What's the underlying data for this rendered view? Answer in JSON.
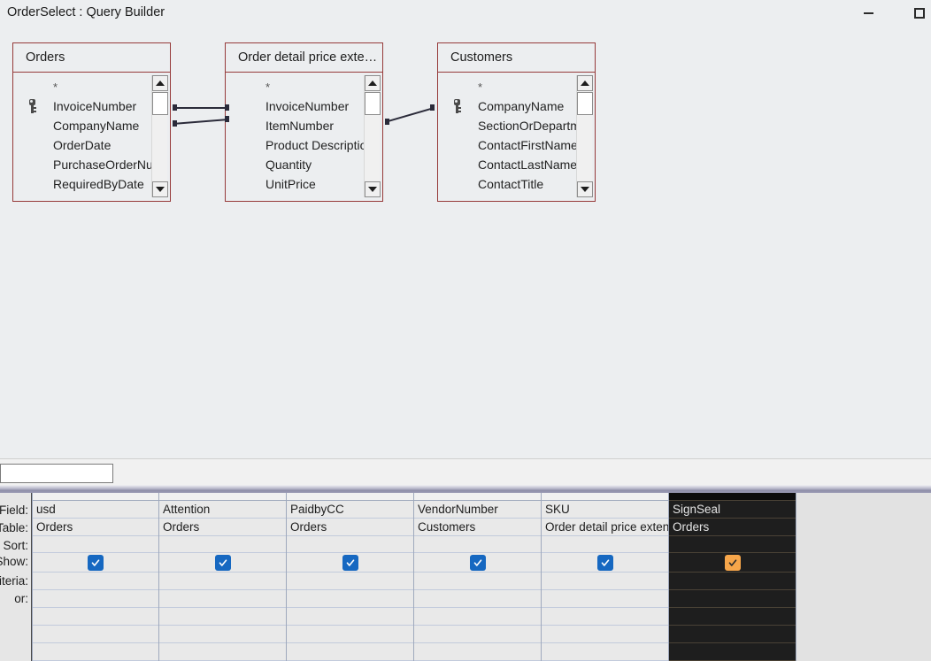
{
  "window": {
    "title": "OrderSelect : Query Builder",
    "minimize_label": "Minimize",
    "maximize_label": "Maximize"
  },
  "diagram": {
    "tables": [
      {
        "name": "Orders",
        "fields": [
          {
            "label": "*",
            "key": false
          },
          {
            "label": "InvoiceNumber",
            "key": true
          },
          {
            "label": "CompanyName",
            "key": false
          },
          {
            "label": "OrderDate",
            "key": false
          },
          {
            "label": "PurchaseOrderNum",
            "key": false
          },
          {
            "label": "RequiredByDate",
            "key": false
          }
        ]
      },
      {
        "name": "Order detail price exte…",
        "fields": [
          {
            "label": "*",
            "key": false
          },
          {
            "label": "InvoiceNumber",
            "key": false
          },
          {
            "label": "ItemNumber",
            "key": false
          },
          {
            "label": "Product Description",
            "key": false
          },
          {
            "label": "Quantity",
            "key": false
          },
          {
            "label": "UnitPrice",
            "key": false
          }
        ]
      },
      {
        "name": "Customers",
        "fields": [
          {
            "label": "*",
            "key": false
          },
          {
            "label": "CompanyName",
            "key": true
          },
          {
            "label": "SectionOrDepartme",
            "key": false
          },
          {
            "label": "ContactFirstName",
            "key": false
          },
          {
            "label": "ContactLastName",
            "key": false
          },
          {
            "label": "ContactTitle",
            "key": false
          }
        ]
      }
    ],
    "joins": [
      {
        "name": "join-orders-orderdetail-1"
      },
      {
        "name": "join-orders-orderdetail-2"
      },
      {
        "name": "join-orderdetail-customers"
      }
    ],
    "scroll_up_icon": "triangle-up-icon",
    "scroll_down_icon": "triangle-down-icon",
    "key_icon": "key-icon"
  },
  "filter_bar": {
    "input_value": "",
    "input_placeholder": ""
  },
  "grid": {
    "row_labels": [
      "Field:",
      "Table:",
      "Sort:",
      "Show:",
      "Criteria:",
      "or:"
    ],
    "columns": [
      {
        "field": "usd",
        "table": "Orders",
        "sort": "",
        "show": true,
        "criteria": "",
        "or": "",
        "selected": false
      },
      {
        "field": "Attention",
        "table": "Orders",
        "sort": "",
        "show": true,
        "criteria": "",
        "or": "",
        "selected": false
      },
      {
        "field": "PaidbyCC",
        "table": "Orders",
        "sort": "",
        "show": true,
        "criteria": "",
        "or": "",
        "selected": false
      },
      {
        "field": "VendorNumber",
        "table": "Customers",
        "sort": "",
        "show": true,
        "criteria": "",
        "or": "",
        "selected": false
      },
      {
        "field": "SKU",
        "table": "Order detail price exten",
        "sort": "",
        "show": true,
        "criteria": "",
        "or": "",
        "selected": false
      },
      {
        "field": "SignSeal",
        "table": "Orders",
        "sort": "",
        "show": true,
        "criteria": "",
        "or": "",
        "selected": true
      }
    ],
    "checkbox_icon": "checkmark-icon",
    "checkbox_color": "#1668c1",
    "checkbox_color_selected": "#f7a64a"
  },
  "colors": {
    "table_border": "#963a3a",
    "background": "#eceef0",
    "selected_column_bg": "#1e1e1e",
    "grid_line": "#c2cbdc"
  }
}
